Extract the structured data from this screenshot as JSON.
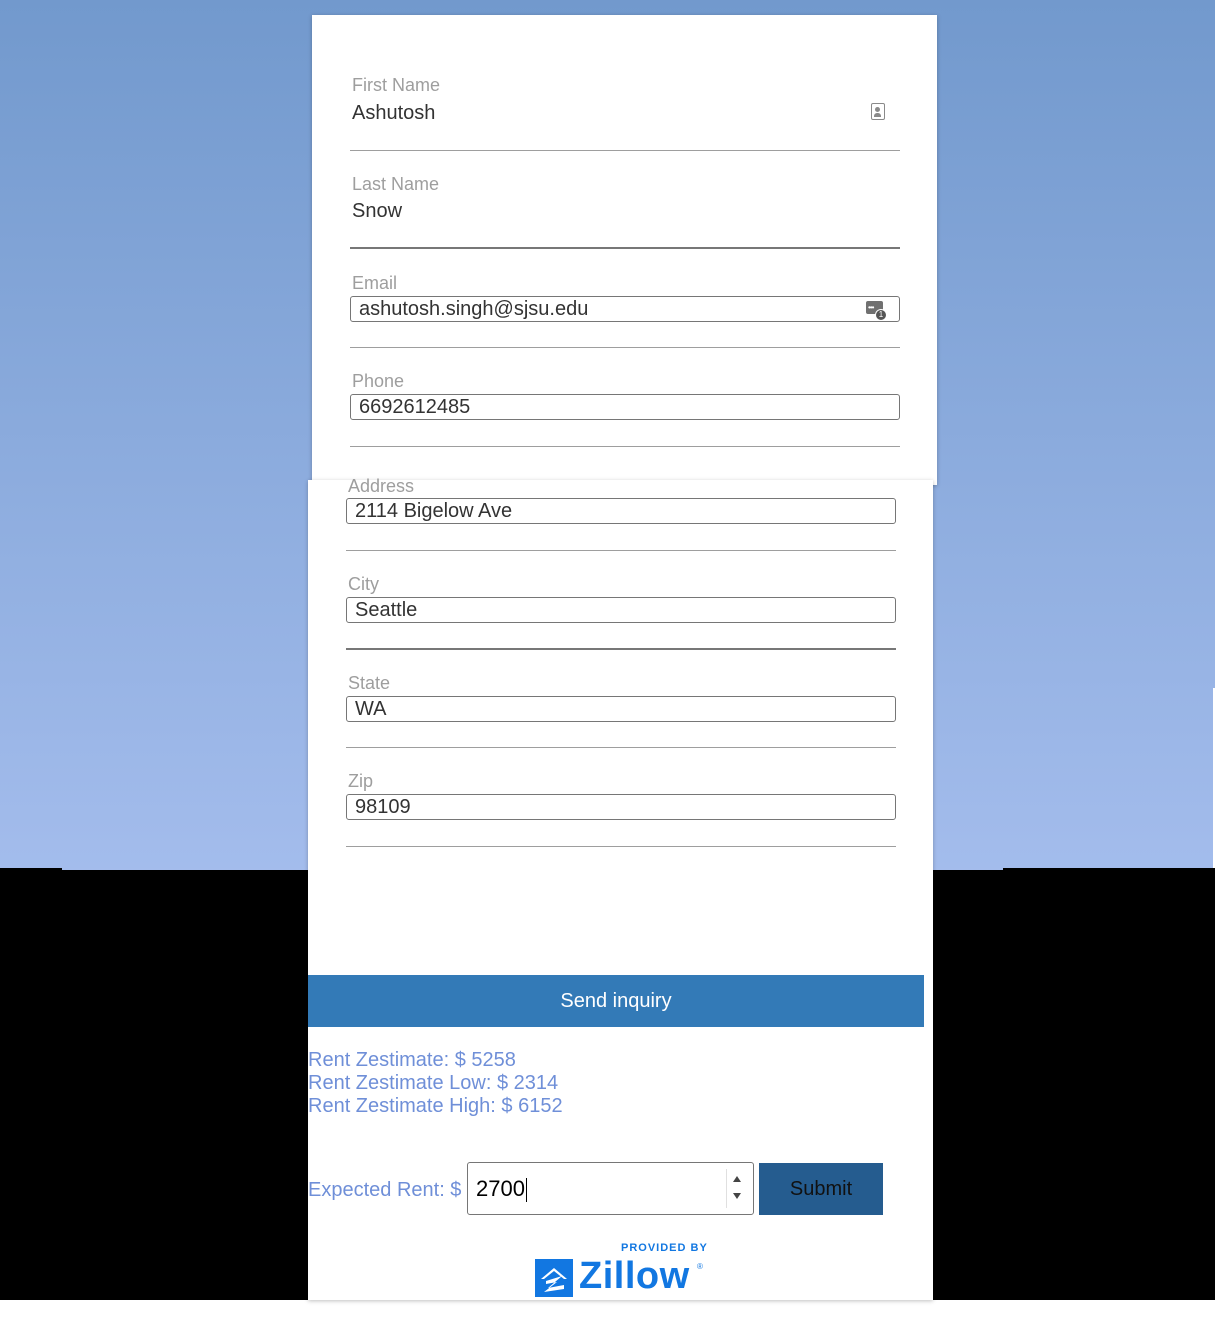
{
  "form": {
    "first_name": {
      "label": "First Name",
      "value": "Ashutosh"
    },
    "last_name": {
      "label": "Last Name",
      "value": "Snow"
    },
    "email": {
      "label": "Email",
      "value": "ashutosh.singh@sjsu.edu"
    },
    "phone": {
      "label": "Phone",
      "value": "6692612485"
    },
    "address": {
      "label": "Address",
      "value": "2114 Bigelow Ave"
    },
    "city": {
      "label": "City",
      "value": "Seattle"
    },
    "state": {
      "label": "State",
      "value": "WA"
    },
    "zip": {
      "label": "Zip",
      "value": "98109"
    },
    "send_label": "Send inquiry"
  },
  "zestimate": {
    "rent": "Rent Zestimate: $ 5258",
    "low": "Rent Zestimate Low: $ 2314",
    "high": "Rent Zestimate High: $ 6152"
  },
  "expected_rent": {
    "label": "Expected Rent: $",
    "value": "2700",
    "submit_label": "Submit"
  },
  "attribution": {
    "provided_by": "PROVIDED BY",
    "brand": "Zillow",
    "reg_mark": "®"
  },
  "icons": {
    "contact_autofill": "contact-card-icon",
    "password_manager": "password-manager-icon"
  },
  "colors": {
    "button_primary": "#337ab7",
    "submit_button": "#255c8f",
    "zestimate_text": "#6f8fd8",
    "zillow_blue": "#1277e1"
  }
}
